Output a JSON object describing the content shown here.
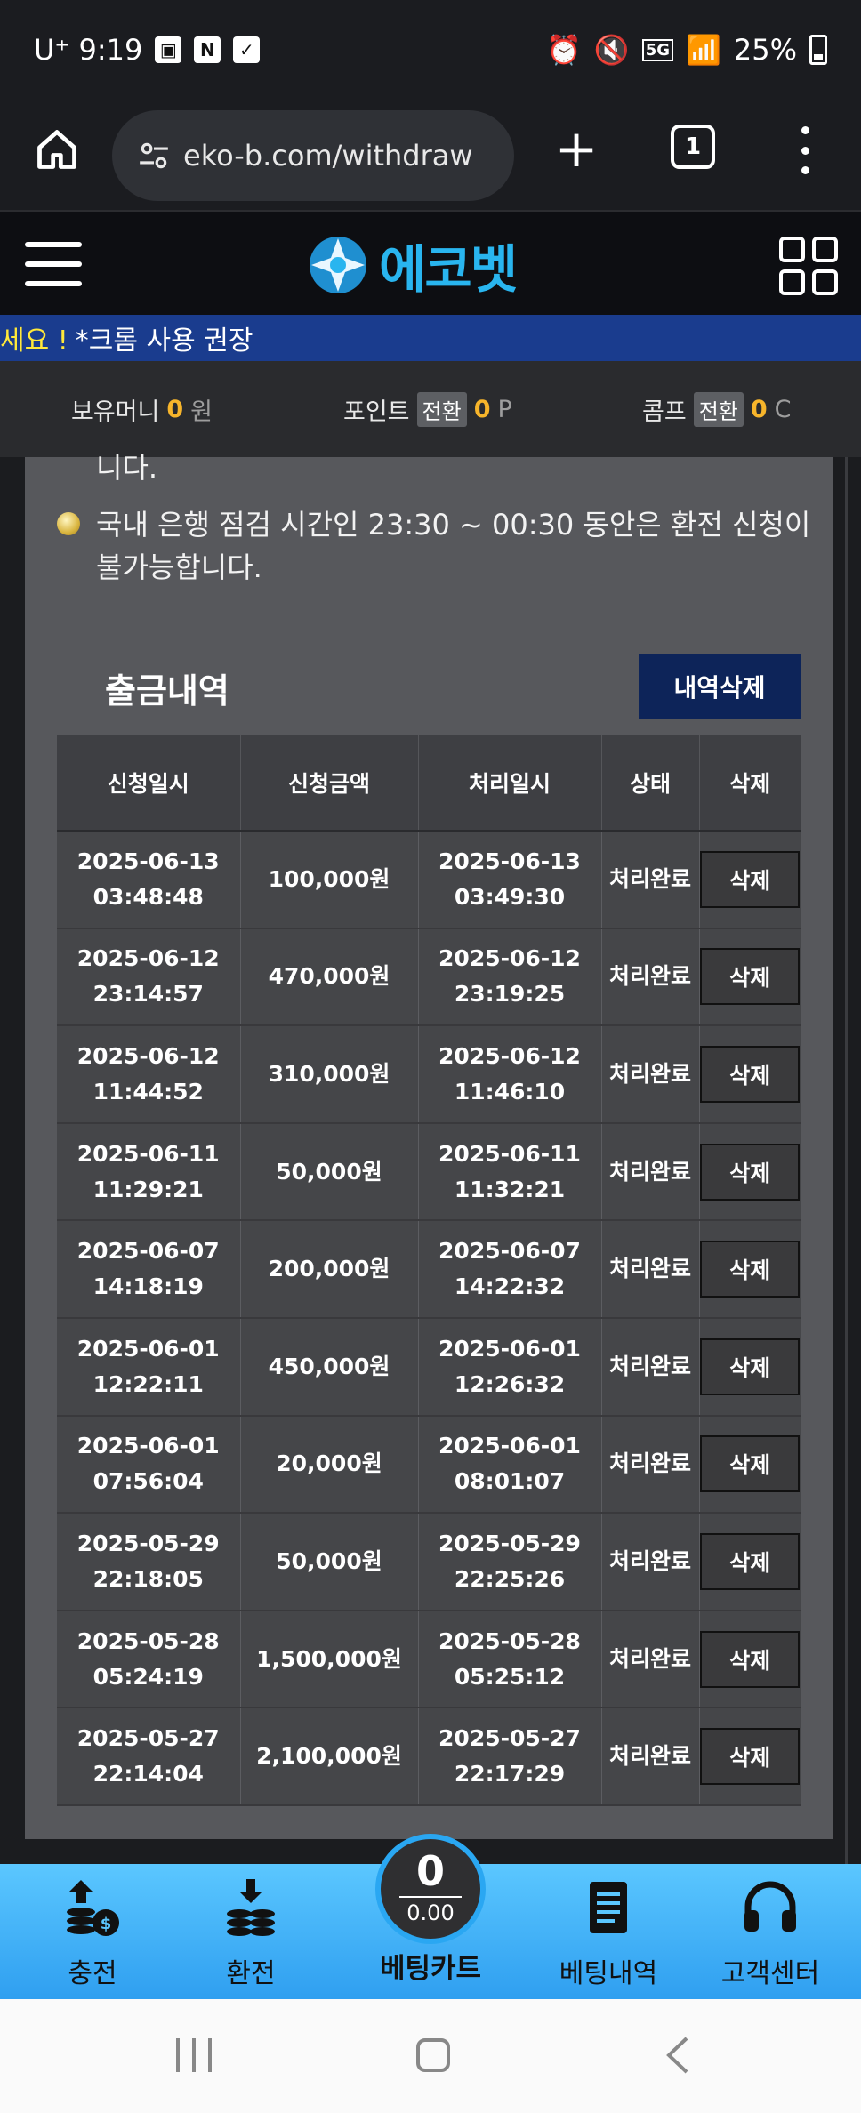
{
  "status_bar": {
    "carrier": "U⁺ 9:19",
    "battery": "25%",
    "network": "5G"
  },
  "browser": {
    "url": "eko-b.com/withdraw",
    "tab_count": "1"
  },
  "site": {
    "logo_text": "에코벳",
    "marquee_highlight": "세요 !",
    "marquee_text": "*크롬 사용 권장"
  },
  "money_bar": {
    "balance_label": "보유머니",
    "balance_value": "0",
    "balance_unit": "원",
    "point_label": "포인트",
    "point_badge": "전환",
    "point_value": "0",
    "point_unit": "P",
    "comp_label": "콤프",
    "comp_badge": "전환",
    "comp_value": "0",
    "comp_unit": "C"
  },
  "notes": {
    "partial_line": "니다.",
    "bank_line1": "국내 은행 점검 시간인 23:30 ~ 00:30 동안은 환전 신청이",
    "bank_line2": "불가능합니다."
  },
  "withdraw_section": {
    "title": "출금내역",
    "delete_history_label": "내역삭제",
    "columns": [
      "신청일시",
      "신청금액",
      "처리일시",
      "상태",
      "삭제"
    ],
    "rows": [
      {
        "req_date": "2025-06-13",
        "req_time": "03:48:48",
        "amount": "100,000원",
        "proc_date": "2025-06-13",
        "proc_time": "03:49:30",
        "status": "처리완료",
        "action": "삭제"
      },
      {
        "req_date": "2025-06-12",
        "req_time": "23:14:57",
        "amount": "470,000원",
        "proc_date": "2025-06-12",
        "proc_time": "23:19:25",
        "status": "처리완료",
        "action": "삭제"
      },
      {
        "req_date": "2025-06-12",
        "req_time": "11:44:52",
        "amount": "310,000원",
        "proc_date": "2025-06-12",
        "proc_time": "11:46:10",
        "status": "처리완료",
        "action": "삭제"
      },
      {
        "req_date": "2025-06-11",
        "req_time": "11:29:21",
        "amount": "50,000원",
        "proc_date": "2025-06-11",
        "proc_time": "11:32:21",
        "status": "처리완료",
        "action": "삭제"
      },
      {
        "req_date": "2025-06-07",
        "req_time": "14:18:19",
        "amount": "200,000원",
        "proc_date": "2025-06-07",
        "proc_time": "14:22:32",
        "status": "처리완료",
        "action": "삭제"
      },
      {
        "req_date": "2025-06-01",
        "req_time": "12:22:11",
        "amount": "450,000원",
        "proc_date": "2025-06-01",
        "proc_time": "12:26:32",
        "status": "처리완료",
        "action": "삭제"
      },
      {
        "req_date": "2025-06-01",
        "req_time": "07:56:04",
        "amount": "20,000원",
        "proc_date": "2025-06-01",
        "proc_time": "08:01:07",
        "status": "처리완료",
        "action": "삭제"
      },
      {
        "req_date": "2025-05-29",
        "req_time": "22:18:05",
        "amount": "50,000원",
        "proc_date": "2025-05-29",
        "proc_time": "22:25:26",
        "status": "처리완료",
        "action": "삭제"
      },
      {
        "req_date": "2025-05-28",
        "req_time": "05:24:19",
        "amount": "1,500,000원",
        "proc_date": "2025-05-28",
        "proc_time": "05:25:12",
        "status": "처리완료",
        "action": "삭제"
      },
      {
        "req_date": "2025-05-27",
        "req_time": "22:14:04",
        "amount": "2,100,000원",
        "proc_date": "2025-05-27",
        "proc_time": "22:17:29",
        "status": "처리완료",
        "action": "삭제"
      }
    ]
  },
  "bottom_nav": {
    "deposit": "충전",
    "withdraw": "환전",
    "cart_count": "0",
    "cart_amount": "0.00",
    "cart_label": "베팅카트",
    "history": "베팅내역",
    "support": "고객센터"
  },
  "icons": {
    "accent_blue": "#29b5ef",
    "highlight_yellow": "#f7b52b",
    "nav_blue": "#2f9ff0"
  }
}
